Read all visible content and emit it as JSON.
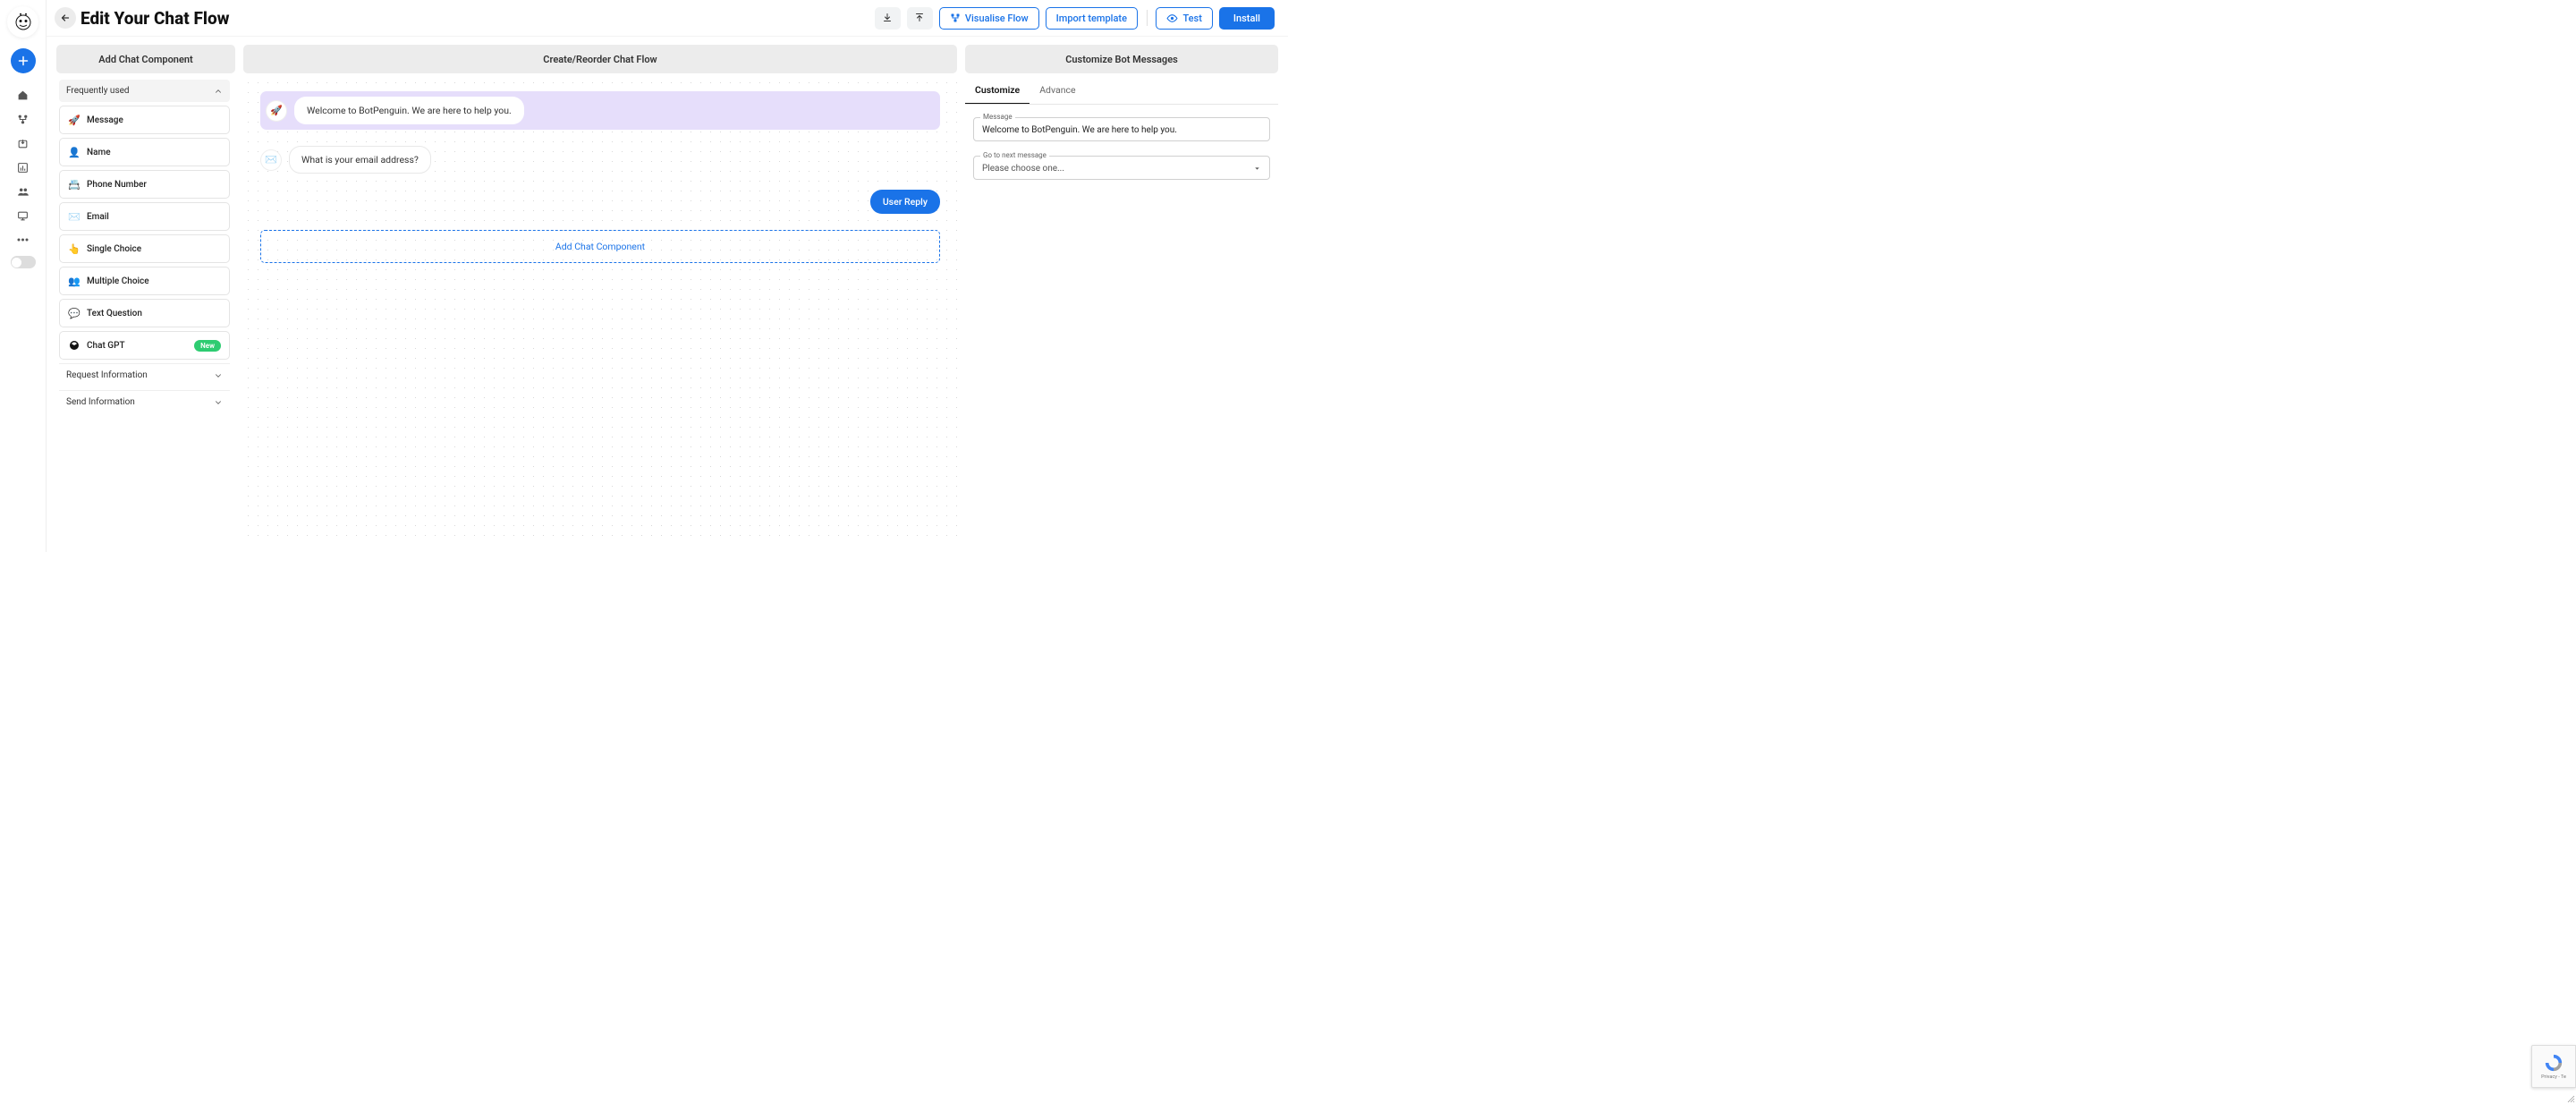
{
  "header": {
    "title": "Edit Your Chat Flow",
    "visualise": "Visualise Flow",
    "import": "Import template",
    "test": "Test",
    "install": "Install"
  },
  "panels": {
    "add": "Add Chat Component",
    "flow": "Create/Reorder Chat Flow",
    "customize": "Customize Bot Messages"
  },
  "groups": {
    "frequently": "Frequently used",
    "request": "Request Information",
    "send": "Send Information"
  },
  "components": {
    "message": "Message",
    "name": "Name",
    "phone": "Phone Number",
    "email": "Email",
    "single": "Single Choice",
    "multiple": "Multiple Choice",
    "textq": "Text Question",
    "chatgpt": "Chat GPT",
    "new_badge": "New"
  },
  "flow": {
    "msg1": "Welcome to BotPenguin. We are here to help you.",
    "msg2": "What is your email address?",
    "user_reply": "User Reply",
    "add_component": "Add Chat Component"
  },
  "customize_panel": {
    "tab_customize": "Customize",
    "tab_advance": "Advance",
    "message_label": "Message",
    "message_value": "Welcome to BotPenguin. We are here to help you.",
    "goto_label": "Go to next message",
    "goto_value": "Please choose one..."
  },
  "recaptcha": {
    "line1": "Privacy - Te"
  }
}
